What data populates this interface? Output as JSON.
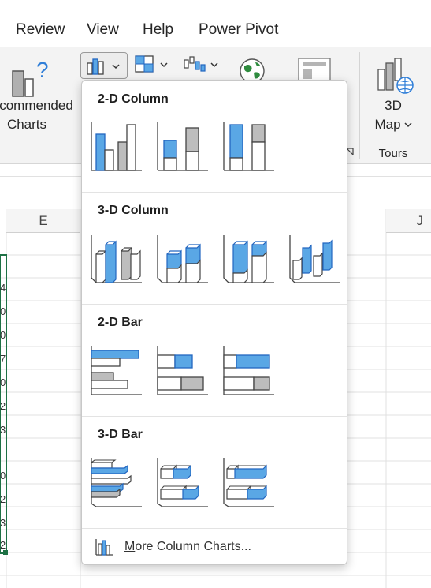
{
  "tabs": [
    "Review",
    "View",
    "Help",
    "Power Pivot"
  ],
  "ribbon": {
    "recommended_line1": "commended",
    "recommended_line2": "Charts",
    "map3d_line1": "3D",
    "map3d_line2": "Map",
    "tours_group": "Tours"
  },
  "columns": {
    "e": "E",
    "j": "J"
  },
  "menu": {
    "sections": [
      {
        "title": "2-D Column",
        "items": [
          "clustered-column",
          "stacked-column",
          "100-percent-stacked-column"
        ]
      },
      {
        "title": "3-D Column",
        "items": [
          "3d-clustered-column",
          "3d-stacked-column",
          "3d-100-percent-stacked-column",
          "3d-column"
        ]
      },
      {
        "title": "2-D Bar",
        "items": [
          "clustered-bar",
          "stacked-bar",
          "100-percent-stacked-bar"
        ]
      },
      {
        "title": "3-D Bar",
        "items": [
          "3d-clustered-bar",
          "3d-stacked-bar",
          "3d-100-percent-stacked-bar"
        ]
      }
    ],
    "more_underlined": "M",
    "more_rest": "ore Column Charts..."
  },
  "colors": {
    "accent_blue": "#5aa7e5",
    "blue_stroke": "#2266c0",
    "gray_fill": "#bdbdbd",
    "selection_green": "#1e7145"
  }
}
